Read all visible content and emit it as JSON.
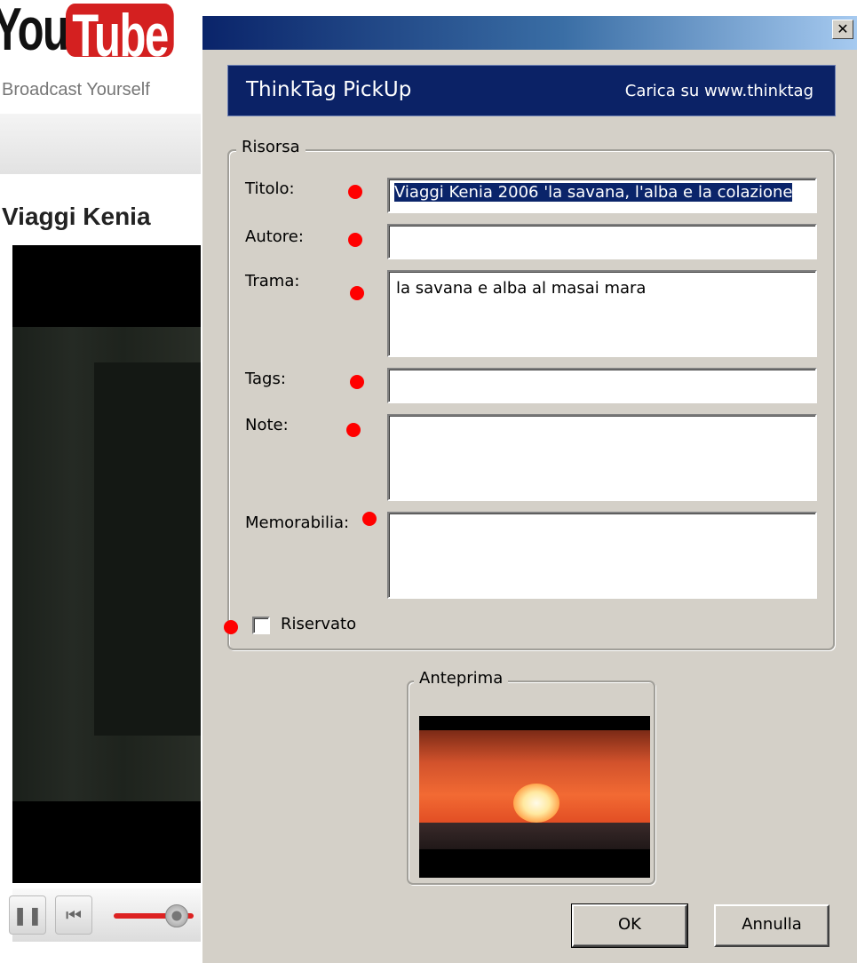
{
  "background_page": {
    "logo_you": "You",
    "logo_tube": "Tube",
    "tagline": "Broadcast Yourself",
    "video_title": "Viaggi Kenia"
  },
  "dialog": {
    "close_glyph": "✕",
    "banner": {
      "title": "ThinkTag PickUp",
      "link": "Carica su www.thinktag"
    },
    "risorsa": {
      "legend": "Risorsa",
      "titolo_label": "Titolo:",
      "titolo_value": "Viaggi Kenia 2006 'la savana, l'alba e la colazione",
      "autore_label": "Autore:",
      "autore_value": "",
      "trama_label": "Trama:",
      "trama_value": "la savana e alba al masai mara",
      "tags_label": "Tags:",
      "tags_value": "",
      "note_label": "Note:",
      "note_value": "",
      "memorabilia_label": "Memorabilia:",
      "memorabilia_value": "",
      "riservato_label": "Riservato",
      "riservato_checked": false
    },
    "anteprima": {
      "legend": "Anteprima"
    },
    "ok_label": "OK",
    "cancel_label": "Annulla"
  },
  "colors": {
    "banner_bg": "#0b2266",
    "dialog_bg": "#d4d0c8",
    "required_dot": "#ff0000",
    "selection": "#0a246a"
  }
}
